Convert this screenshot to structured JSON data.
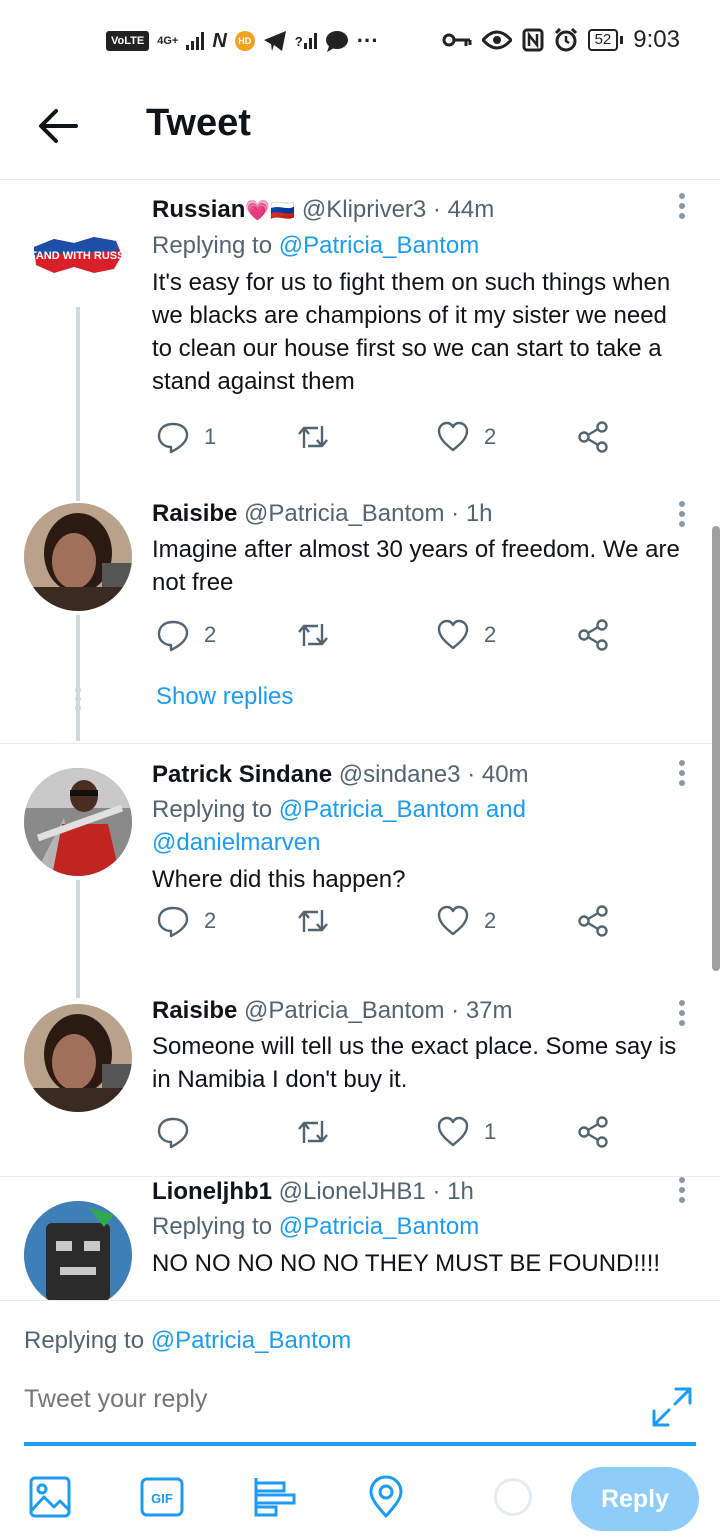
{
  "status_bar": {
    "volte": "VoLTE",
    "network": "4G+",
    "hd_badge": "HD",
    "wifi_glyph": "?",
    "more": "···",
    "battery": "52",
    "time": "9:03"
  },
  "header": {
    "title": "Tweet"
  },
  "tweets": [
    {
      "name": "Russian",
      "emoji": "💗🇷🇺",
      "meta": "@Klipriver3 · 44m",
      "replying_prefix": "Replying to ",
      "replying_to": "@Patricia_Bantom",
      "text": "It's easy for us to fight them on such things when we blacks are champions of it my sister we need to clean our house first so we can start to take a stand against them",
      "avatar_text": "I STAND WITH RUSSIA",
      "replies": "1",
      "retweets": "",
      "likes": "2"
    },
    {
      "name": "Raisibe",
      "meta": "@Patricia_Bantom · 1h",
      "text": "Imagine after almost 30 years of freedom. We are not free",
      "replies": "2",
      "retweets": "",
      "likes": "2"
    },
    {
      "name": "Patrick Sindane",
      "meta": "@sindane3 · 40m",
      "replying_prefix": "Replying to ",
      "replying_to": "@Patricia_Bantom and @danielmarven",
      "text": "Where did this happen?",
      "replies": "2",
      "retweets": "",
      "likes": "2"
    },
    {
      "name": "Raisibe",
      "meta": "@Patricia_Bantom · 37m",
      "text": "Someone will tell us the exact place. Some say is in Namibia I don't buy it.",
      "replies": "",
      "retweets": "",
      "likes": "1"
    },
    {
      "name": "Lioneljhb1",
      "meta": "@LionelJHB1 · 1h",
      "replying_prefix": "Replying to ",
      "replying_to": "@Patricia_Bantom",
      "text": "NO NO NO NO NO THEY MUST BE FOUND!!!!",
      "replies": "",
      "retweets": "",
      "likes": ""
    }
  ],
  "show_replies": "Show replies",
  "composer": {
    "replying_prefix": "Replying to ",
    "replying_to": "@Patricia_Bantom",
    "placeholder": "Tweet your reply",
    "reply_label": "Reply"
  },
  "colors": {
    "accent": "#1d9bf0",
    "reply_button_disabled": "#8ecdf8",
    "text_secondary": "#536471",
    "thread_line": "#cfd9de"
  },
  "icons": [
    "back-arrow-icon",
    "more-vertical-icon",
    "reply-icon",
    "retweet-icon",
    "like-icon",
    "share-icon",
    "expand-icon",
    "image-icon",
    "gif-icon",
    "poll-icon",
    "location-icon"
  ]
}
